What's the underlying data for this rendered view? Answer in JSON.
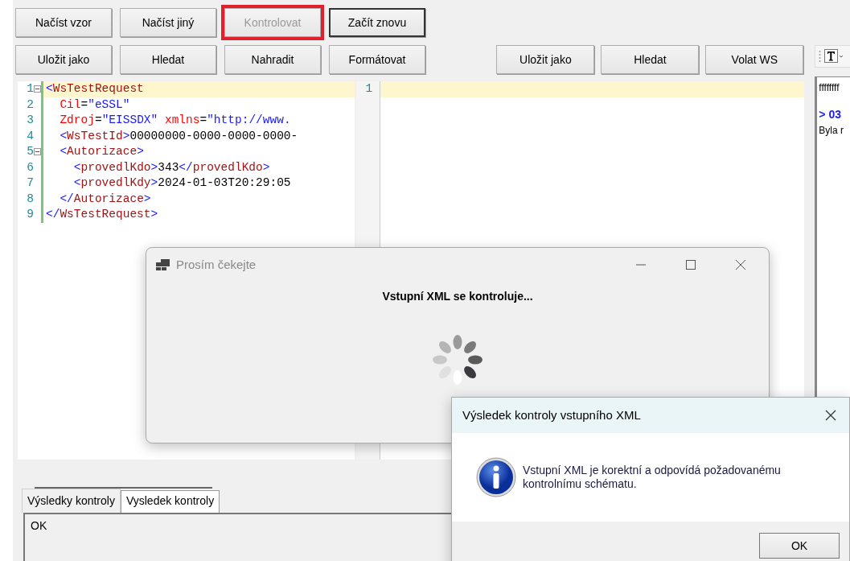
{
  "toolbar_row_1": [
    {
      "label": "Načíst vzor",
      "disabled": false,
      "highlighted": false,
      "default": false
    },
    {
      "label": "Načíst jiný",
      "disabled": false,
      "highlighted": false,
      "default": false
    },
    {
      "label": "Kontrolovat",
      "disabled": true,
      "highlighted": true,
      "default": false
    },
    {
      "label": "Začít znovu",
      "disabled": false,
      "highlighted": false,
      "default": true
    }
  ],
  "toolbar_row_2": [
    {
      "label": "Uložit jako",
      "disabled": false
    },
    {
      "label": "Hledat",
      "disabled": false
    },
    {
      "label": "Nahradit",
      "disabled": false
    },
    {
      "label": "Formátovat",
      "disabled": false
    }
  ],
  "response_toolbar": [
    {
      "label": "Uložit jako",
      "disabled": false
    },
    {
      "label": "Hledat",
      "disabled": false
    },
    {
      "label": "Volat WS",
      "disabled": false
    }
  ],
  "request_editor": {
    "lines": [
      {
        "number": "1",
        "fold": true,
        "current": true,
        "segments": [
          {
            "kind": "bracket",
            "text": "<"
          },
          {
            "kind": "tag",
            "text": "WsTestRequest"
          }
        ]
      },
      {
        "number": "2",
        "fold": false,
        "current": false,
        "segments": [
          {
            "kind": "attr",
            "text": "  Cil"
          },
          {
            "kind": "text",
            "text": "="
          },
          {
            "kind": "value",
            "text": "\"eSSL\""
          }
        ]
      },
      {
        "number": "3",
        "fold": false,
        "current": false,
        "segments": [
          {
            "kind": "attr",
            "text": "  Zdroj"
          },
          {
            "kind": "text",
            "text": "="
          },
          {
            "kind": "value",
            "text": "\"EISSDX\""
          },
          {
            "kind": "attr",
            "text": " xmlns"
          },
          {
            "kind": "text",
            "text": "="
          },
          {
            "kind": "value",
            "text": "\"http://www."
          }
        ]
      },
      {
        "number": "4",
        "fold": false,
        "current": false,
        "segments": [
          {
            "kind": "bracket",
            "text": "  <"
          },
          {
            "kind": "tag",
            "text": "WsTestId"
          },
          {
            "kind": "bracket",
            "text": ">"
          },
          {
            "kind": "text",
            "text": "00000000-0000-0000-0000-"
          }
        ]
      },
      {
        "number": "5",
        "fold": true,
        "current": false,
        "segments": [
          {
            "kind": "bracket",
            "text": "  <"
          },
          {
            "kind": "tag",
            "text": "Autorizace"
          },
          {
            "kind": "bracket",
            "text": ">"
          }
        ]
      },
      {
        "number": "6",
        "fold": false,
        "current": false,
        "segments": [
          {
            "kind": "bracket",
            "text": "    <"
          },
          {
            "kind": "tag",
            "text": "provedlKdo"
          },
          {
            "kind": "bracket",
            "text": ">"
          },
          {
            "kind": "text",
            "text": "343"
          },
          {
            "kind": "bracket",
            "text": "</"
          },
          {
            "kind": "tag",
            "text": "provedlKdo"
          },
          {
            "kind": "bracket",
            "text": ">"
          }
        ]
      },
      {
        "number": "7",
        "fold": false,
        "current": false,
        "segments": [
          {
            "kind": "bracket",
            "text": "    <"
          },
          {
            "kind": "tag",
            "text": "provedlKdy"
          },
          {
            "kind": "bracket",
            "text": ">"
          },
          {
            "kind": "text",
            "text": "2024-01-03T20:29:05"
          }
        ]
      },
      {
        "number": "8",
        "fold": false,
        "current": false,
        "segments": [
          {
            "kind": "bracket",
            "text": "  </"
          },
          {
            "kind": "tag",
            "text": "Autorizace"
          },
          {
            "kind": "bracket",
            "text": ">"
          }
        ]
      },
      {
        "number": "9",
        "fold": false,
        "current": false,
        "segments": [
          {
            "kind": "bracket",
            "text": "</"
          },
          {
            "kind": "tag",
            "text": "WsTestRequest"
          },
          {
            "kind": "bracket",
            "text": ">"
          }
        ]
      }
    ]
  },
  "response_editor": {
    "lines": [
      {
        "number": "1",
        "current": true
      }
    ]
  },
  "log_panel": {
    "lines": [
      {
        "kind": "plain",
        "text": "ffffffff"
      },
      {
        "kind": "heading",
        "text": "> 03"
      },
      {
        "kind": "plain",
        "text": "Byla r"
      }
    ]
  },
  "result_tabs": [
    {
      "label": "Výsledky kontroly",
      "selected": false
    },
    {
      "label": "Vysledek kontroly",
      "selected": true
    }
  ],
  "result_text": "OK",
  "wait_dialog": {
    "title": "Prosím čekejte",
    "message": "Vstupní XML se kontroluje..."
  },
  "result_dialog": {
    "title": "Výsledek kontroly vstupního XML",
    "message": "Vstupní XML je korektní a odpovídá požadovanému kontrolnímu schématu.",
    "buttons": [
      "OK"
    ]
  }
}
